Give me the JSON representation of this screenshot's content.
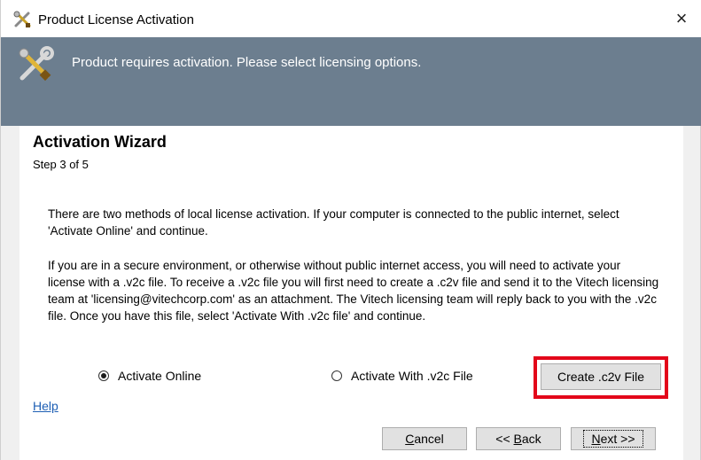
{
  "window": {
    "title": "Product License Activation",
    "close_symbol": "×"
  },
  "banner": {
    "message": "Product requires activation. Please select licensing options."
  },
  "wizard": {
    "title": "Activation Wizard",
    "step": "Step 3 of 5",
    "paragraph1": "There are two methods of local license activation. If your computer is connected to the public internet, select 'Activate Online' and continue.",
    "paragraph2": "If you are in a secure environment, or otherwise without public internet access, you will need to activate your license with a .v2c file. To receive a .v2c file you will first need to create a .c2v file and send it to the Vitech licensing team at 'licensing@vitechcorp.com' as an attachment. The Vitech licensing team will reply back to you with the .v2c file. Once you have this file, select 'Activate With .v2c file' and continue."
  },
  "options": {
    "online_label": "Activate Online",
    "online_selected": true,
    "v2c_label": "Activate With .v2c File",
    "v2c_selected": false
  },
  "buttons": {
    "create_c2v": "Create .c2v File",
    "help": "Help",
    "cancel_first": "C",
    "cancel_rest": "ancel",
    "back_prefix": "<< ",
    "back_first": "B",
    "back_rest": "ack",
    "next_first": "N",
    "next_rest": "ext >>"
  },
  "colors": {
    "banner_bg": "#6c7e8f",
    "highlight_border": "#e3061a",
    "link": "#1e5fb4"
  },
  "icons": {
    "title_icon": "tools-icon",
    "banner_icon": "tools-icon"
  }
}
